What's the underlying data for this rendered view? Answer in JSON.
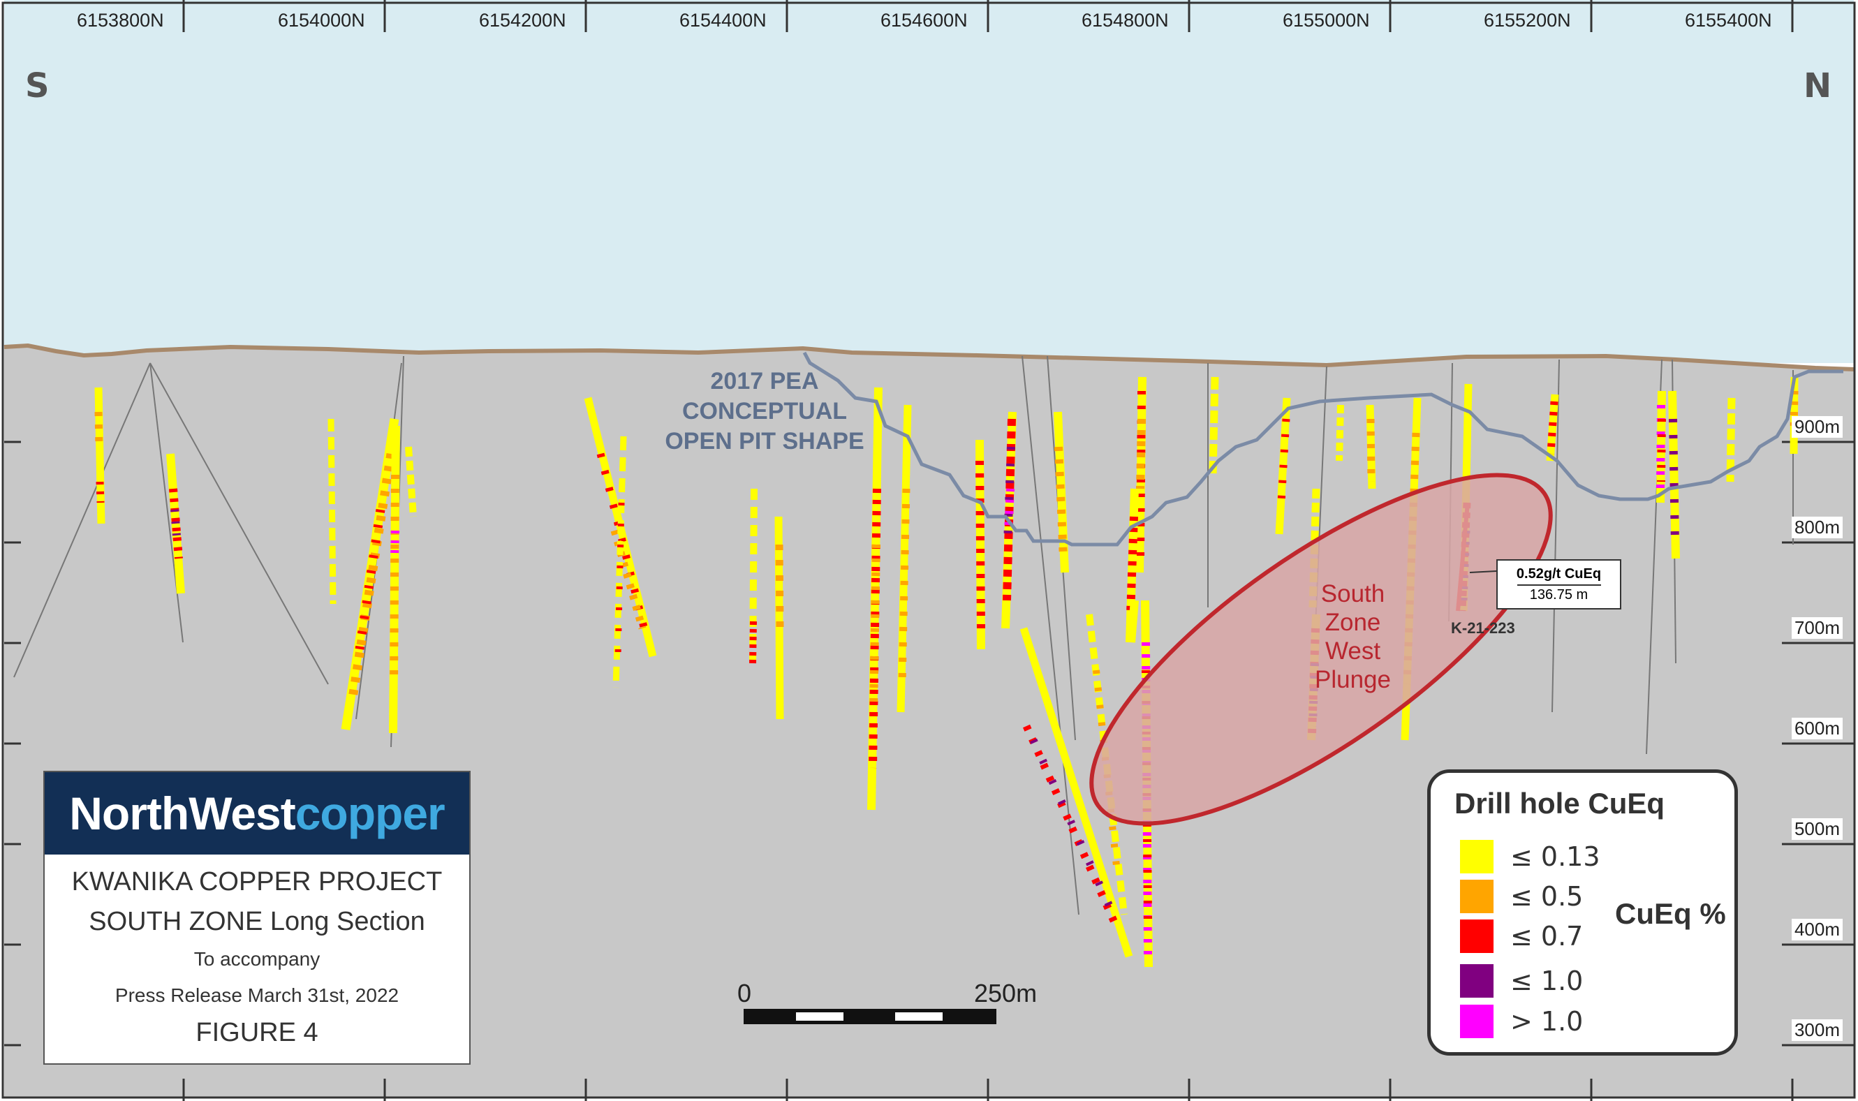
{
  "northings": [
    "6153800N",
    "6154000N",
    "6154200N",
    "6154400N",
    "6154600N",
    "6154800N",
    "6155000N",
    "6155200N",
    "6155400N"
  ],
  "elevations": [
    "900m",
    "800m",
    "700m",
    "600m",
    "500m",
    "400m",
    "300m"
  ],
  "directions": {
    "south": "S",
    "north": "N"
  },
  "pit_label": [
    "2017 PEA",
    "CONCEPTUAL",
    "OPEN PIT SHAPE"
  ],
  "zone_label": [
    "South",
    "Zone",
    "West",
    "Plunge"
  ],
  "callout": {
    "value": "0.52g/t CuEq",
    "length": "136.75 m",
    "hole_id": "K-21-223"
  },
  "scale_bar": {
    "start": "0",
    "end": "250m"
  },
  "title_box": {
    "logo_part1": "NorthWest",
    "logo_part2": "copper",
    "project": "KWANIKA COPPER PROJECT",
    "section": "SOUTH ZONE Long Section",
    "accompany": "To accompany",
    "press": "Press Release March 31st, 2022",
    "figure": "FIGURE 4"
  },
  "legend": {
    "title": "Drill hole CuEq",
    "unit": "CuEq %",
    "items": [
      {
        "label": "≤ 0.13",
        "color": "#ffff00"
      },
      {
        "label": "≤ 0.5",
        "color": "#ffa500"
      },
      {
        "label": "≤ 0.7",
        "color": "#ff0000"
      },
      {
        "label": "≤ 1.0",
        "color": "#800080"
      },
      {
        "label": "> 1.0",
        "color": "#ff00ff"
      }
    ]
  },
  "colors": {
    "sky": "#d9ecf2",
    "ground": "#c8c8c8",
    "topography": "#a8896b",
    "pit_outline": "#7b8ba6",
    "zone_fill": "#d8a6a6",
    "zone_stroke": "#c0272d",
    "logo_band": "#122f55",
    "logo_accent": "#3fa9e0"
  }
}
